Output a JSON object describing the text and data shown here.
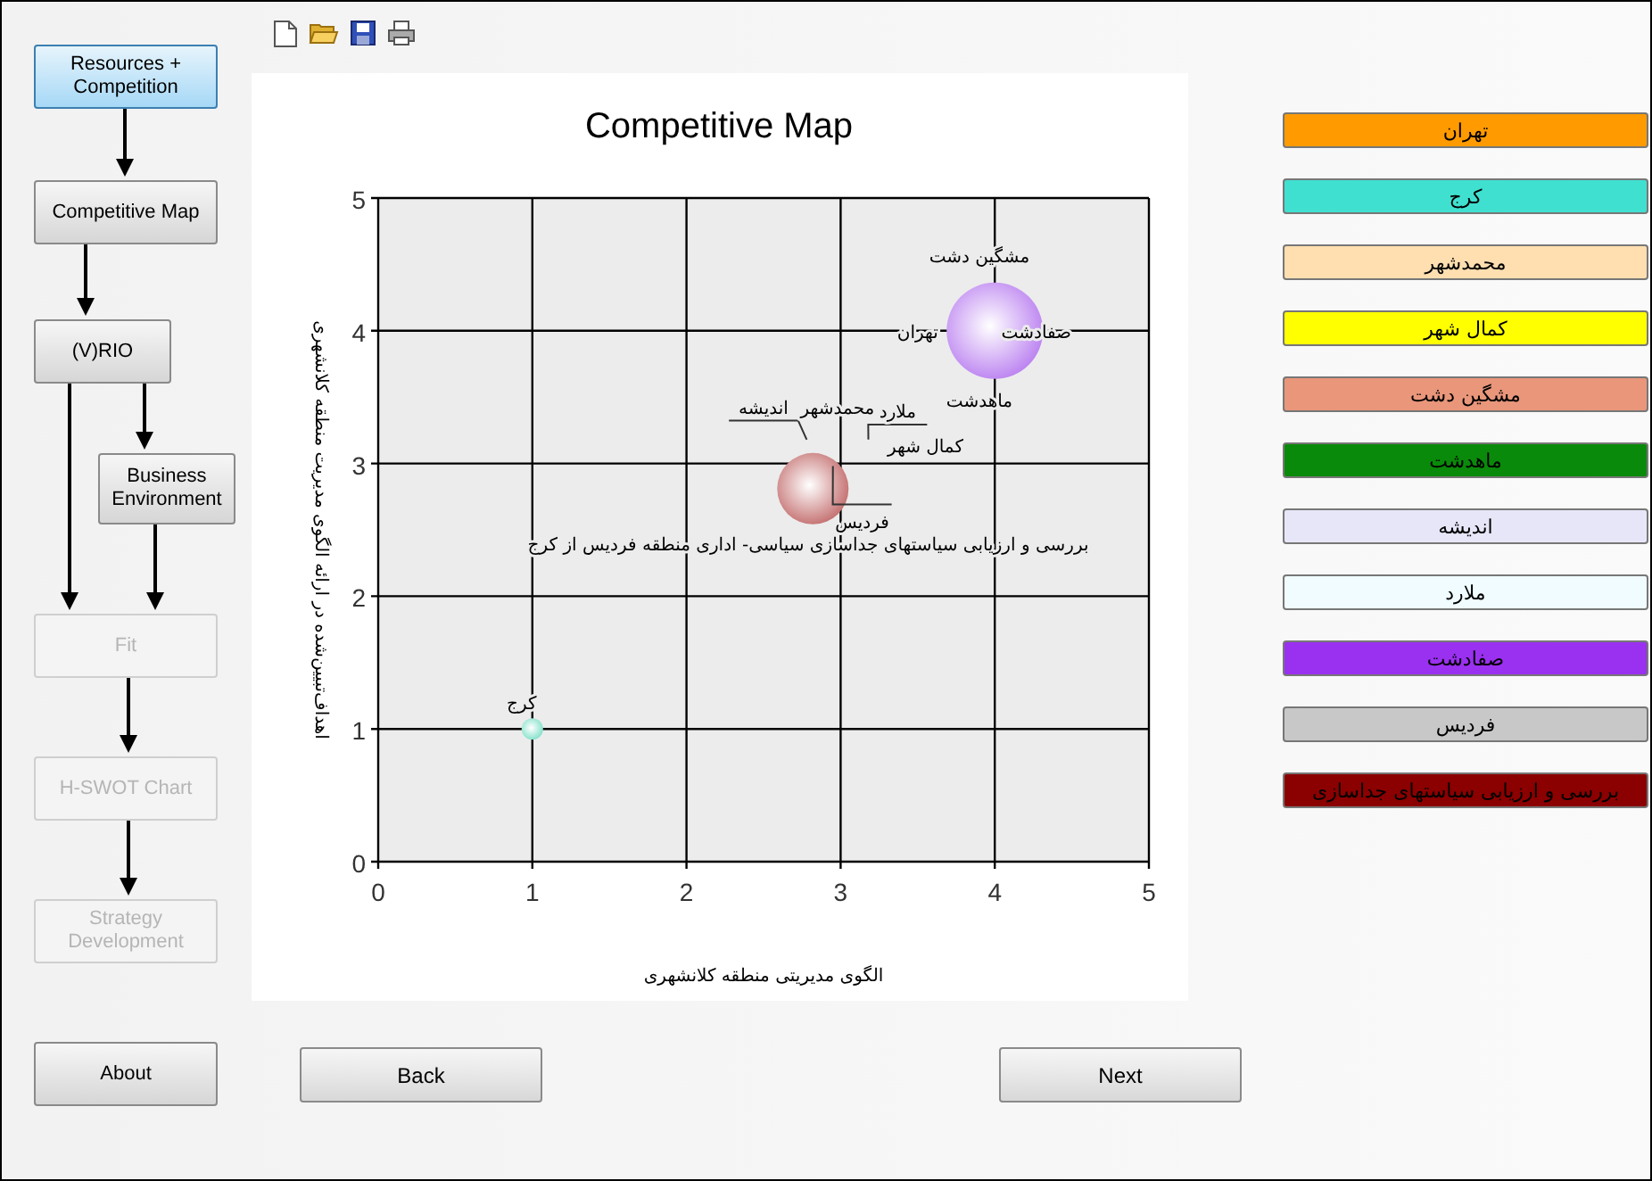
{
  "flow": [
    {
      "label": "Resources + Competition",
      "selected": true,
      "disabled": false
    },
    {
      "label": "Competitive Map",
      "selected": false,
      "disabled": false
    },
    {
      "label": "(V)RIO",
      "selected": false,
      "disabled": false
    },
    {
      "label": "Business Environment",
      "selected": false,
      "disabled": false
    },
    {
      "label": "Fit",
      "selected": false,
      "disabled": true
    },
    {
      "label": "H-SWOT Chart",
      "selected": false,
      "disabled": true
    },
    {
      "label": "Strategy Development",
      "selected": false,
      "disabled": true
    },
    {
      "label": "About",
      "selected": false,
      "disabled": false
    }
  ],
  "chart": {
    "chart_data": {
      "type": "scatter",
      "title": "Competitive Map",
      "xlabel": "الگوی مدیریتی منطقه کلانشهری",
      "ylabel": "اهداف‌تبیین‌شده در ارائه الگوی مدیریت منطقه کلانشهری",
      "x": [
        1,
        2.82,
        4
      ],
      "xlim": [
        0,
        5
      ],
      "ylim": [
        0,
        5
      ],
      "xticks": [
        0,
        1,
        2,
        3,
        4,
        5
      ],
      "grid": true,
      "yticks": [
        0,
        1,
        2,
        3,
        4,
        5
      ],
      "series": [
        {
          "name": "کرج",
          "color": "#7fe0c8",
          "values": [
            1,
            null,
            null
          ]
        },
        {
          "name": "بررسی و ارزیابی سیاستهای جداسازی سیاسی- اداری منطقه فردیس از کرج",
          "color": "#c26a6a",
          "values": [
            null,
            2.81,
            null
          ]
        },
        {
          "name": "صفادشت",
          "color": "#b97ef0",
          "values": [
            null,
            null,
            4
          ]
        }
      ],
      "annotations": [
        "مشگین دشت",
        "تهران",
        "ماهدشت",
        "اندیشه",
        "محمدشهر",
        "ملارد",
        "کمال شهر",
        "فردیس"
      ]
    }
  },
  "legend": [
    {
      "label": "تهران",
      "color": "#ff9a00"
    },
    {
      "label": "کرج",
      "color": "#40e0d0"
    },
    {
      "label": "محمدشهر",
      "color": "#ffdeb0"
    },
    {
      "label": "کمال شهر",
      "color": "#ffff00"
    },
    {
      "label": "مشگین دشت",
      "color": "#e9967a"
    },
    {
      "label": "ماهدشت",
      "color": "#0a8a0a"
    },
    {
      "label": "اندیشه",
      "color": "#e6e6f8"
    },
    {
      "label": "ملارد",
      "color": "#f0fcff"
    },
    {
      "label": "صفادشت",
      "color": "#9a30f0"
    },
    {
      "label": "فردیس",
      "color": "#c8c8c8"
    },
    {
      "label": "بررسی و ارزیابی سیاستهای جداسازی",
      "color": "#8b0000"
    }
  ],
  "back_button": {
    "label": "Back"
  },
  "next_button": {
    "label": "Next"
  }
}
